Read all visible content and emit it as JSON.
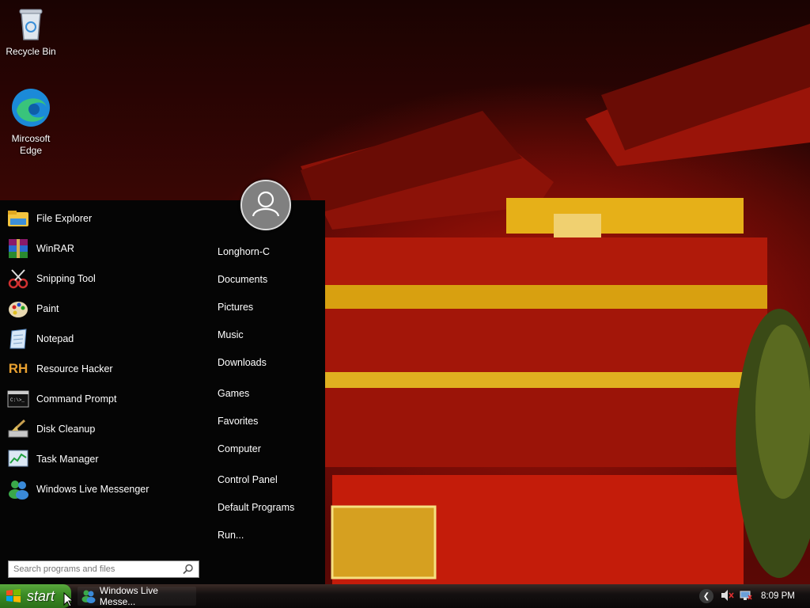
{
  "desktop": {
    "icons": [
      {
        "label": "Recycle Bin",
        "icon": "recycle-bin-icon"
      },
      {
        "label": "Mircosoft\nEdge",
        "icon": "edge-icon"
      }
    ]
  },
  "start_menu": {
    "programs": [
      {
        "label": "File Explorer",
        "icon": "folder-icon"
      },
      {
        "label": "WinRAR",
        "icon": "winrar-icon"
      },
      {
        "label": "Snipping Tool",
        "icon": "scissors-icon"
      },
      {
        "label": "Paint",
        "icon": "paint-palette-icon"
      },
      {
        "label": "Notepad",
        "icon": "notepad-icon"
      },
      {
        "label": "Resource Hacker",
        "icon": "rh-icon"
      },
      {
        "label": "Command Prompt",
        "icon": "cmd-icon"
      },
      {
        "label": "Disk Cleanup",
        "icon": "disk-cleanup-icon"
      },
      {
        "label": "Task Manager",
        "icon": "task-manager-icon"
      },
      {
        "label": "Windows Live Messenger",
        "icon": "messenger-icon"
      }
    ],
    "places": [
      "Longhorn-C",
      "Documents",
      "Pictures",
      "Music",
      "Downloads",
      "Games",
      "Favorites",
      "Computer",
      "Control Panel",
      "Default Programs",
      "Run..."
    ],
    "search_placeholder": "Search programs and files"
  },
  "taskbar": {
    "start_label": "start",
    "task_item": "Windows Live Messe...",
    "clock": "8:09 PM"
  },
  "colors": {
    "start_green": "#3a8a24",
    "menu_bg": "#050505"
  }
}
